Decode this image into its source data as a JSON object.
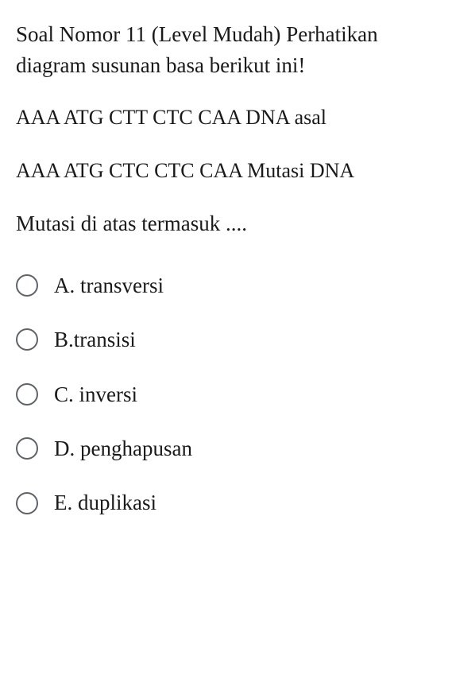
{
  "question": {
    "title": "Soal Nomor 11 (Level Mudah)",
    "instruction": "Perhatikan diagram susunan basa berikut ini!",
    "sequence1": "AAA ATG CTT CTC CAA DNA asal",
    "sequence2": "AAA ATG CTC CTC CAA Mutasi DNA",
    "prompt": "Mutasi di atas termasuk ...."
  },
  "options": [
    {
      "label": "A. transversi"
    },
    {
      "label": "B.transisi"
    },
    {
      "label": "C. inversi"
    },
    {
      "label": "D. penghapusan"
    },
    {
      "label": "E. duplikasi"
    }
  ]
}
